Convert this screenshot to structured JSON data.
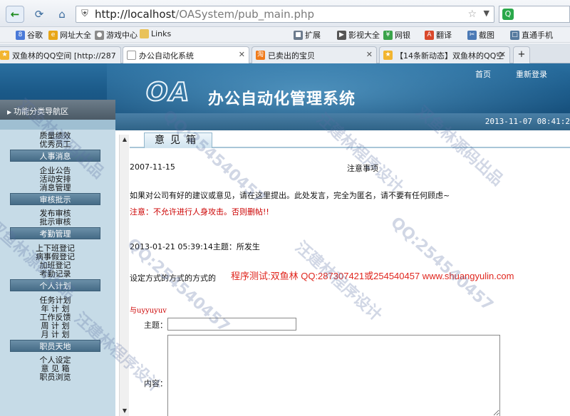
{
  "browser": {
    "url_host": "http://localhost",
    "url_path": "/OASystem/pub_main.php",
    "bookmarks": [
      "谷歌",
      "网址大全",
      "游戏中心",
      "Links",
      "扩展",
      "影视大全",
      "网银",
      "翻译",
      "截图",
      "直通手机"
    ],
    "tabs": [
      {
        "label": "双鱼林的QQ空间 [http://287"
      },
      {
        "label": "办公自动化系统"
      },
      {
        "label": "已卖出的宝贝"
      },
      {
        "label": "【14条新动态】双鱼林的QQ空"
      }
    ],
    "new_tab_glyph": "+"
  },
  "header": {
    "logo": "OA",
    "title": "办公自动化管理系统",
    "links": {
      "home": "首页",
      "relogin": "重新登录"
    },
    "datetime": "2013-11-07  08:41:2"
  },
  "sidebar": {
    "title": "功能分类导航区",
    "top_items": [
      "质量绩效",
      "优秀员工"
    ],
    "sections": [
      {
        "label": "人事消息",
        "items": [
          "企业公告",
          "活动安排",
          "消息管理"
        ]
      },
      {
        "label": "审核批示",
        "items": [
          "发布审核",
          "批示审核"
        ]
      },
      {
        "label": "考勤管理",
        "items": [
          "上下班登记",
          "病事假登记",
          "加班登记",
          "考勤记录"
        ]
      },
      {
        "label": "个人计划",
        "items": [
          "任务计划",
          "年 计 划",
          "工作反馈",
          "周 计 划",
          "月 计 划"
        ]
      },
      {
        "label": "职员天地",
        "items": [
          "个人设定",
          "意 见 箱",
          "职员浏览"
        ]
      }
    ]
  },
  "content": {
    "tab": "意见箱",
    "date1": "2007-11-15",
    "note_title": "注意事项",
    "intro": "如果对公司有好的建议或意见，请在这里提出。此处发言，完全为匿名，请不要有任何顾虑~",
    "warning": "注意：不允许进行人身攻击。否则删帖!!",
    "post_line": "2013-01-21 05:39:14主题：所发生",
    "post_body": "设定方式的方式的方式的",
    "promo": "程序测试:双鱼林 QQ:287307421或254540457 www.shuangyulin.com",
    "reply": "与uyyuyuv",
    "subject_label": "主题：",
    "content_label": "内容："
  },
  "watermarks": [
    "双鱼林源码出品",
    "QQ:254540457",
    "汪建林程序设计",
    "双鱼林源码出品",
    "QQ:254540457",
    "汪建林程序设计",
    "双鱼林源码出品",
    "QQ:254540457",
    "汪建林程序设计"
  ]
}
